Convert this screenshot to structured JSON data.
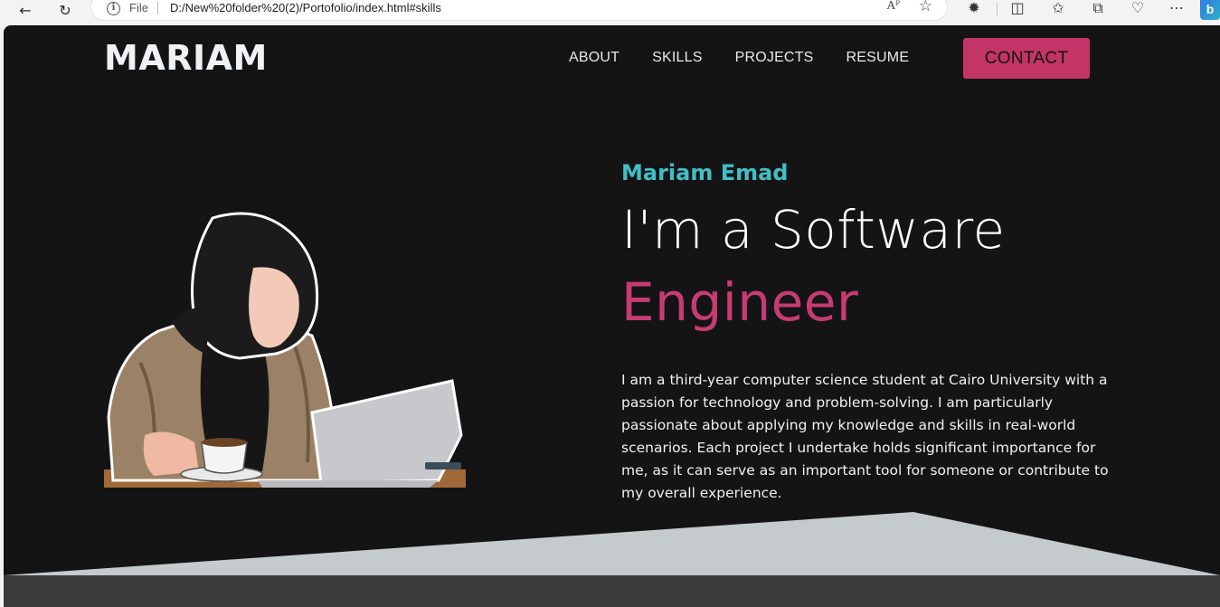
{
  "browser": {
    "file_label": "File",
    "url": "D:/New%20folder%20(2)/Portofolio/index.html#skills",
    "read_aloud": "Aᴾ"
  },
  "site": {
    "logo": "MARIAM",
    "nav": [
      {
        "label": "ABOUT"
      },
      {
        "label": "SKILLS"
      },
      {
        "label": "PROJECTS"
      },
      {
        "label": "RESUME"
      }
    ],
    "contact_label": "CONTACT"
  },
  "hero": {
    "name": "Mariam Emad",
    "line1": "I'm a Software",
    "line2": "Engineer",
    "description": "I am a third-year computer science student at Cairo University with a passion for technology and problem-solving. I am particularly passionate about applying my knowledge and skills in real-world scenarios. Each project I undertake holds significant importance for me, as it can serve as an important tool for someone or contribute to my overall experience."
  },
  "colors": {
    "background": "#151415",
    "accent_pink": "#c33467",
    "accent_teal": "#3fc0c6",
    "slope": "#c5cacd",
    "band": "#3a3b3b"
  },
  "icons": {
    "back": "arrow-left-icon",
    "refresh": "refresh-icon",
    "info": "info-icon",
    "favorite": "star-icon",
    "extensions": "puzzle-icon",
    "split": "split-screen-icon",
    "favorites_bar": "favorites-icon",
    "collections": "collections-icon",
    "performance": "heart-icon",
    "more": "more-icon",
    "bing": "bing-icon"
  }
}
